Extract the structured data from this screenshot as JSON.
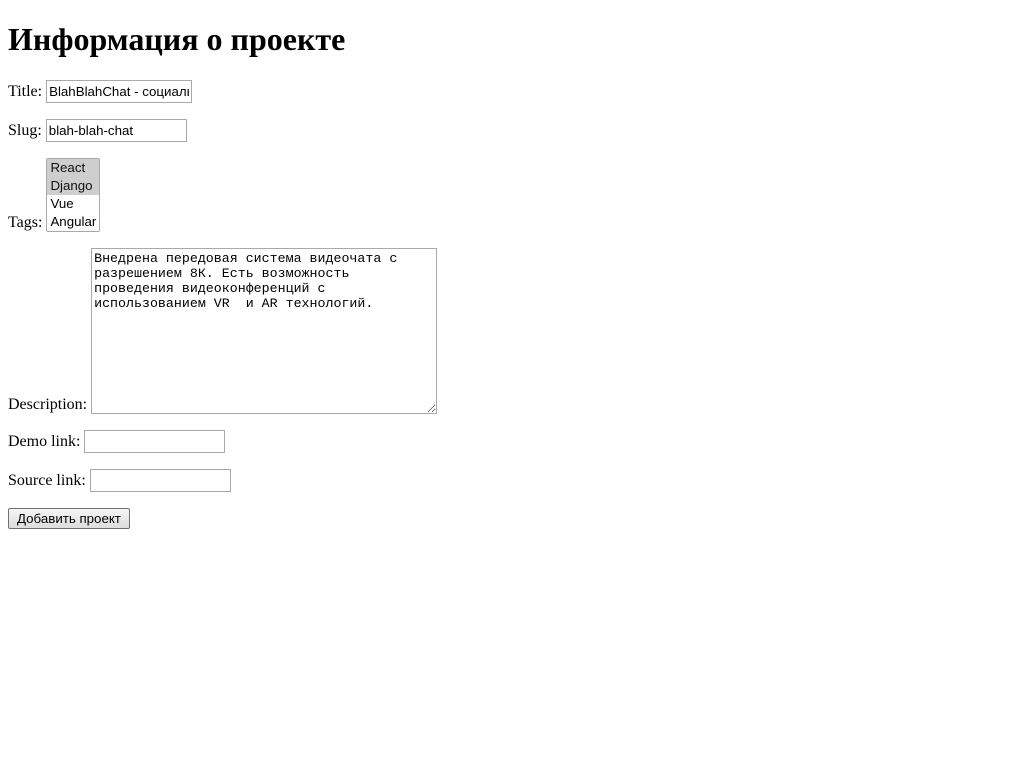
{
  "heading": "Информация о проекте",
  "labels": {
    "title": "Title:",
    "slug": "Slug:",
    "tags": "Tags:",
    "description": "Description:",
    "demo": "Demo link:",
    "source": "Source link:"
  },
  "fields": {
    "title": "BlahBlahChat - социальная сеть",
    "slug": "blah-blah-chat",
    "description": "Внедрена передовая система видеочата с разрешением 8К. Есть возможность проведения видеоконференций с использованием VR  и AR технологий.",
    "demo": "",
    "source": ""
  },
  "tags": {
    "options": [
      "React",
      "Django",
      "Vue",
      "Angular"
    ],
    "selected": [
      "React",
      "Django"
    ]
  },
  "submit_label": "Добавить проект"
}
